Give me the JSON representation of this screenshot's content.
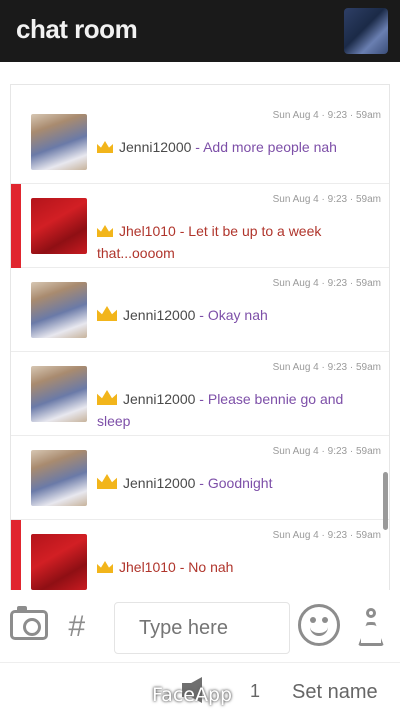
{
  "header": {
    "title": "chat room"
  },
  "messages": [
    {
      "time": "Sun Aug 4 · 9:23 · 59am",
      "user": "Jenni12000",
      "text": "Add more people nah",
      "avatar": "photo",
      "accent": "none",
      "color": "purple"
    },
    {
      "time": "Sun Aug 4 · 9:23 · 59am",
      "user": "Jhel1010",
      "text": "Let it be up to a week that...oooom",
      "avatar": "red",
      "accent": "red",
      "color": "red"
    },
    {
      "time": "Sun Aug 4 · 9:23 · 59am",
      "user": "Jenni12000",
      "text": "Okay nah",
      "avatar": "photo",
      "accent": "none",
      "color": "purple"
    },
    {
      "time": "Sun Aug 4 · 9:23 · 59am",
      "user": "Jenni12000",
      "text": "Please bennie go and sleep",
      "avatar": "photo",
      "accent": "none",
      "color": "purple"
    },
    {
      "time": "Sun Aug 4 · 9:23 · 59am",
      "user": "Jenni12000",
      "text": "Goodnight",
      "avatar": "photo",
      "accent": "none",
      "color": "purple"
    },
    {
      "time": "Sun Aug 4 · 9:23 · 59am",
      "user": "Jhel1010",
      "text": "No nah",
      "avatar": "red",
      "accent": "red",
      "color": "red"
    }
  ],
  "composer": {
    "placeholder": "Type here"
  },
  "bottom_bar": {
    "volume_count": "1",
    "set_name": "Set name"
  },
  "watermark": "FaceApp",
  "colors": {
    "header_bg": "#1a1a1a",
    "accent_red": "#e0262f",
    "purple_text": "#7d4fa8",
    "red_text": "#b0352c",
    "crown": "#f2b51b"
  }
}
